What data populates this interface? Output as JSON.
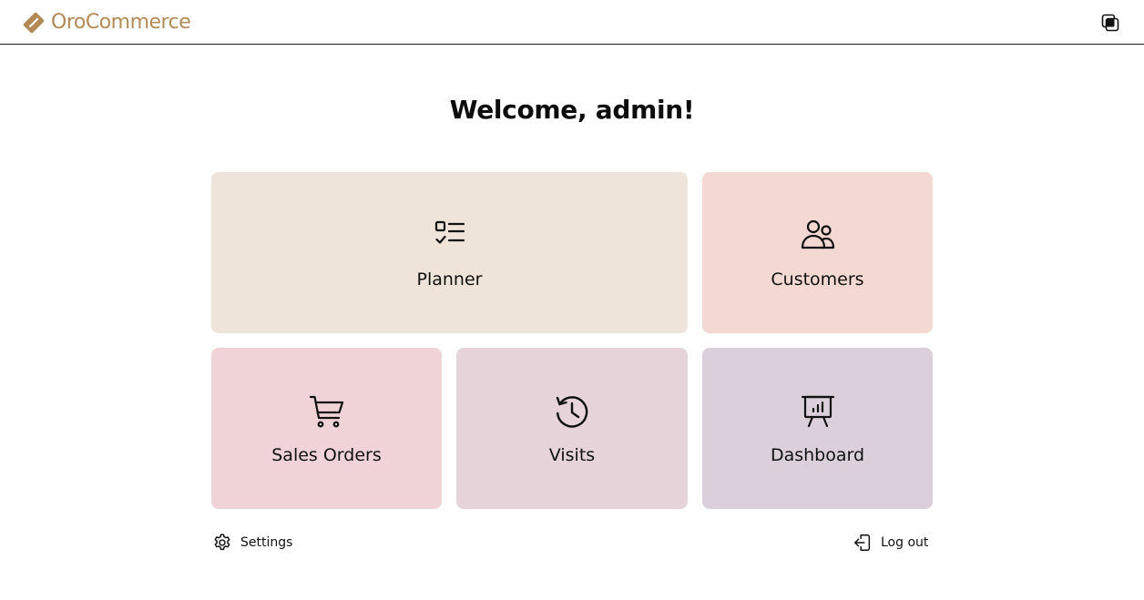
{
  "header": {
    "brand": "OroCommerce"
  },
  "welcome": "Welcome, admin!",
  "colors": {
    "brand": "#b38a56",
    "tile_planner": "#efe4d9",
    "tile_customers": "#f4d9d2",
    "tile_sales_orders": "#f0d3d6",
    "tile_visits": "#e7d3da",
    "tile_dashboard": "#dccfdc"
  },
  "tiles": [
    {
      "label": "Planner",
      "icon": "checklist-icon"
    },
    {
      "label": "Customers",
      "icon": "users-icon"
    },
    {
      "label": "Sales Orders",
      "icon": "shopping-cart-icon"
    },
    {
      "label": "Visits",
      "icon": "history-clock-icon"
    },
    {
      "label": "Dashboard",
      "icon": "presentation-chart-icon"
    }
  ],
  "footer": {
    "settings_label": "Settings",
    "logout_label": "Log out"
  }
}
